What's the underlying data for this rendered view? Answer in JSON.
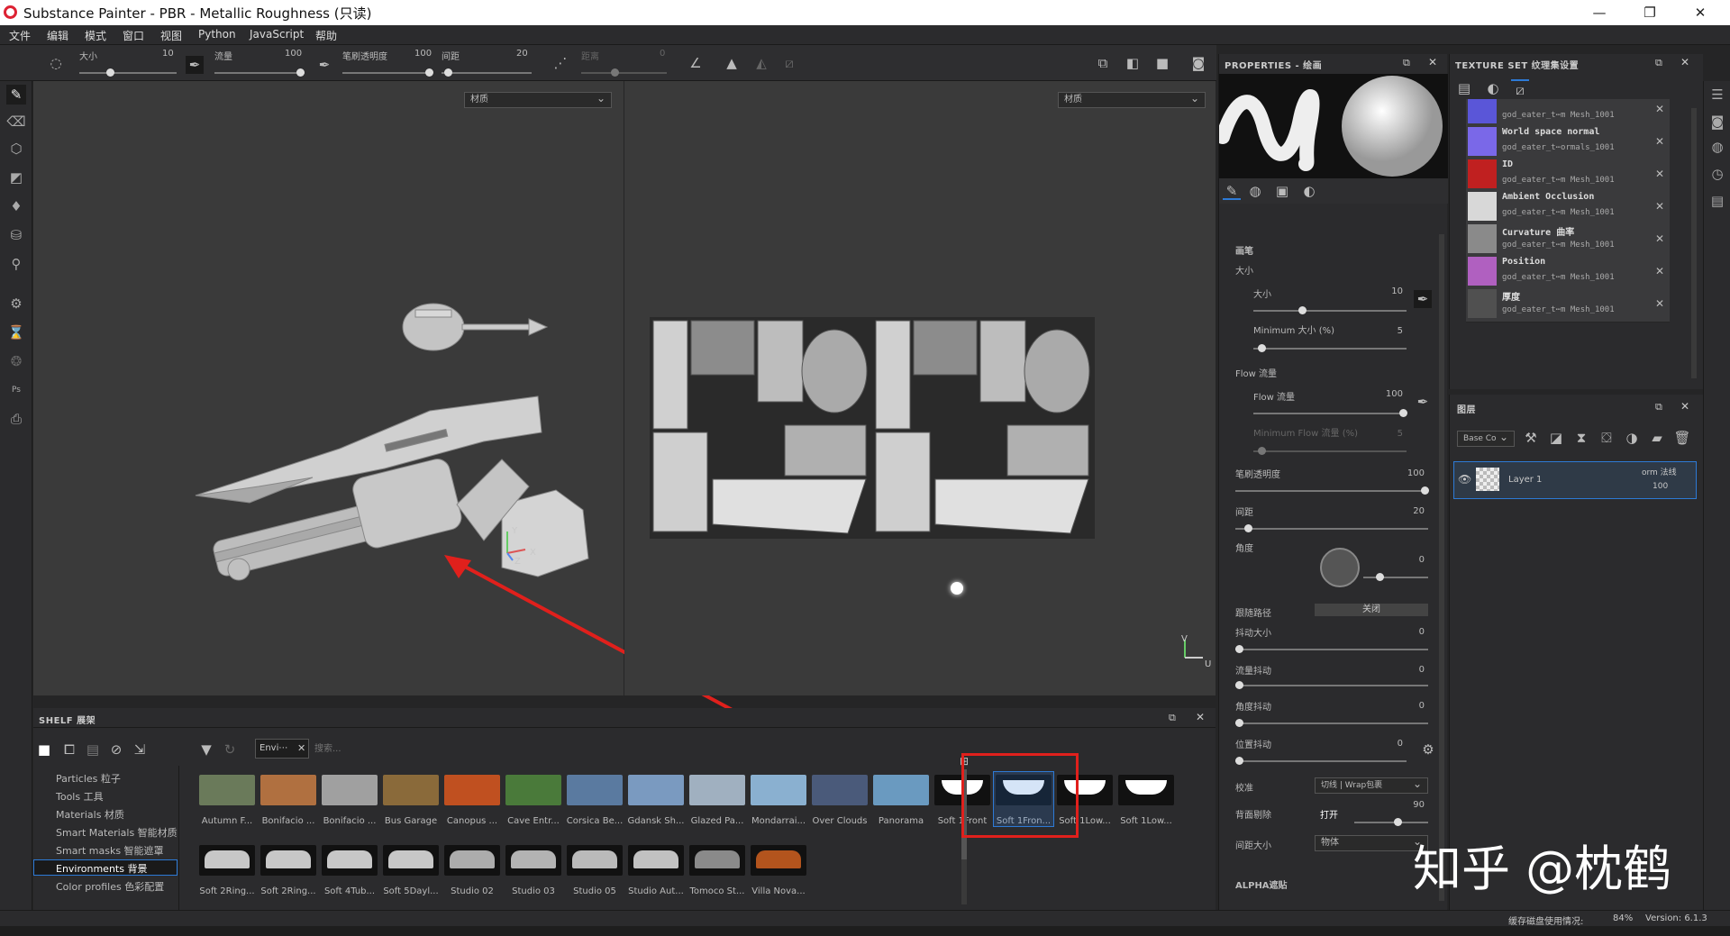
{
  "window": {
    "title": "Substance Painter - PBR - Metallic Roughness (只读)"
  },
  "menu": [
    "文件",
    "编辑",
    "模式",
    "窗口",
    "视图",
    "Python",
    "JavaScript",
    "帮助"
  ],
  "toolbar": {
    "size_label": "大小",
    "size_value": "10",
    "flow_label": "流量",
    "flow_value": "100",
    "opacity_label": "笔刷透明度",
    "opacity_value": "100",
    "spacing_label": "间距",
    "spacing_value": "20",
    "distance_label": "距离",
    "distance_value": "0"
  },
  "viewport": {
    "left_dropdown": "材质",
    "right_dropdown": "材质"
  },
  "shelf": {
    "title": "SHELF 展架",
    "filter_tag": "Envi⋯",
    "search_placeholder": "搜索...",
    "categories": [
      "Particles 粒子",
      "Tools 工具",
      "Materials 材质",
      "Smart Materials 智能材质",
      "Smart masks 智能遮罩",
      "Environments 背景",
      "Color profiles 色彩配置"
    ],
    "selected_category": "Environments 背景",
    "row1": [
      "Autumn F...",
      "Bonifacio ...",
      "Bonifacio ...",
      "Bus Garage",
      "Canopus ...",
      "Cave Entr...",
      "Corsica Be...",
      "Gdansk Sh...",
      "Glazed Pa...",
      "Mondarrai...",
      "Over Clouds",
      "Panorama",
      "Soft 1Front",
      "Soft 1Fron...",
      "Soft 1Low...",
      "Soft 1Low..."
    ],
    "row2": [
      "Soft 2Ring...",
      "Soft 2Ring...",
      "Soft 4Tub...",
      "Soft 5Dayl...",
      "Studio 02",
      "Studio 03",
      "Studio 05",
      "Studio Aut...",
      "Tomoco St...",
      "Villa Nova..."
    ]
  },
  "properties": {
    "title": "PROPERTIES - 绘画",
    "section": "画笔",
    "size_group": "大小",
    "size": "大小",
    "size_value": "10",
    "min_size": "Minimum 大小 (%)",
    "min_size_value": "5",
    "flow_group": "Flow 流量",
    "flow": "Flow 流量",
    "flow_value": "100",
    "min_flow": "Minimum Flow 流量 (%)",
    "min_flow_value": "5",
    "opacity": "笔刷透明度",
    "opacity_value": "100",
    "spacing": "间距",
    "spacing_value": "20",
    "angle": "角度",
    "angle_value": "0",
    "follow_path": "跟随路径",
    "follow_path_value": "关闭",
    "jitter_size": "抖动大小",
    "jitter_size_value": "0",
    "jitter_flow": "流量抖动",
    "jitter_flow_value": "0",
    "jitter_angle": "角度抖动",
    "jitter_angle_value": "0",
    "jitter_pos": "位置抖动",
    "jitter_pos_value": "0",
    "align": "校准",
    "align_value": "切线 | Wrap包裹",
    "backface": "背面剔除",
    "backface_value": "打开",
    "backface_num": "90",
    "spacing_size": "间距大小",
    "spacing_size_value": "物体",
    "alpha": "ALPHA遮贴"
  },
  "texset": {
    "title": "TEXTURE SET 纹理集设置",
    "channels": [
      {
        "name": "",
        "sub": "god_eater_t⋯m Mesh_1001",
        "color": "#5a56d8"
      },
      {
        "name": "World space normal",
        "sub": "god_eater_t⋯ormals_1001",
        "color": "#7a68e8"
      },
      {
        "name": "ID",
        "sub": "god_eater_t⋯m Mesh_1001",
        "color": "#c02020"
      },
      {
        "name": "Ambient Occlusion",
        "sub": "god_eater_t⋯m Mesh_1001",
        "color": "#d8d8d8"
      },
      {
        "name": "Curvature 曲率",
        "sub": "god_eater_t⋯m Mesh_1001",
        "color": "#8a8a8a"
      },
      {
        "name": "Position",
        "sub": "god_eater_t⋯m Mesh_1001",
        "color": "#b060c0"
      },
      {
        "name": "厚度",
        "sub": "god_eater_t⋯m Mesh_1001",
        "color": "#505050"
      }
    ]
  },
  "layers": {
    "title": "图层",
    "blend_select": "Base Co",
    "layer_name": "Layer 1",
    "blend_mode": "orm 法线",
    "opacity": "100"
  },
  "status": {
    "cache": "缓存磁盘使用情况:",
    "percent": "84%",
    "version": "Version: 6.1.3"
  },
  "watermark": "知乎 @枕鹤",
  "axes": {
    "y": "Y",
    "x": "X",
    "z": "Z",
    "v": "V",
    "u": "U"
  }
}
